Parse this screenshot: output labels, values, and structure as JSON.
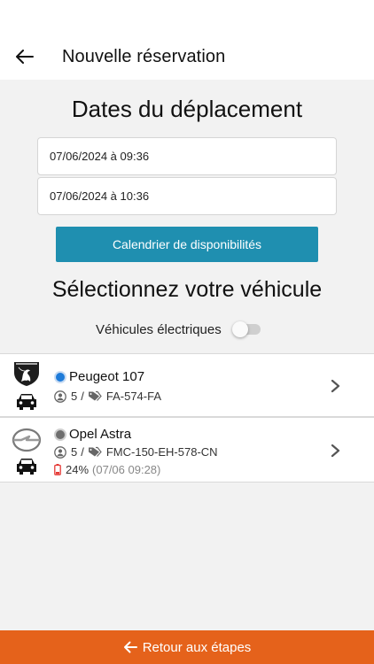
{
  "header": {
    "title": "Nouvelle réservation"
  },
  "dates": {
    "title": "Dates du déplacement",
    "start": "07/06/2024 à 09:36",
    "end": "07/06/2024 à 10:36",
    "calendar_button": "Calendrier de disponibilités"
  },
  "vehicles": {
    "title": "Sélectionnez votre véhicule",
    "electric_filter_label": "Véhicules électriques",
    "electric_filter_on": false,
    "items": [
      {
        "brand_icon": "peugeot-logo",
        "selected": true,
        "name": "Peugeot 107",
        "seats": "5",
        "separator": "/",
        "plate": "FA-574-FA"
      },
      {
        "brand_icon": "opel-logo",
        "selected": false,
        "name": "Opel Astra",
        "seats": "5",
        "separator": "/",
        "plate": "FMC-150-EH-578-CN",
        "battery": "24%",
        "battery_date": "(07/06 09:28)"
      }
    ]
  },
  "footer": {
    "back_label": "Retour aux étapes"
  },
  "colors": {
    "accent": "#1f8fb0",
    "footer": "#e5621b",
    "radio_selected": "#1e7bd9",
    "battery_low": "#e53935"
  }
}
